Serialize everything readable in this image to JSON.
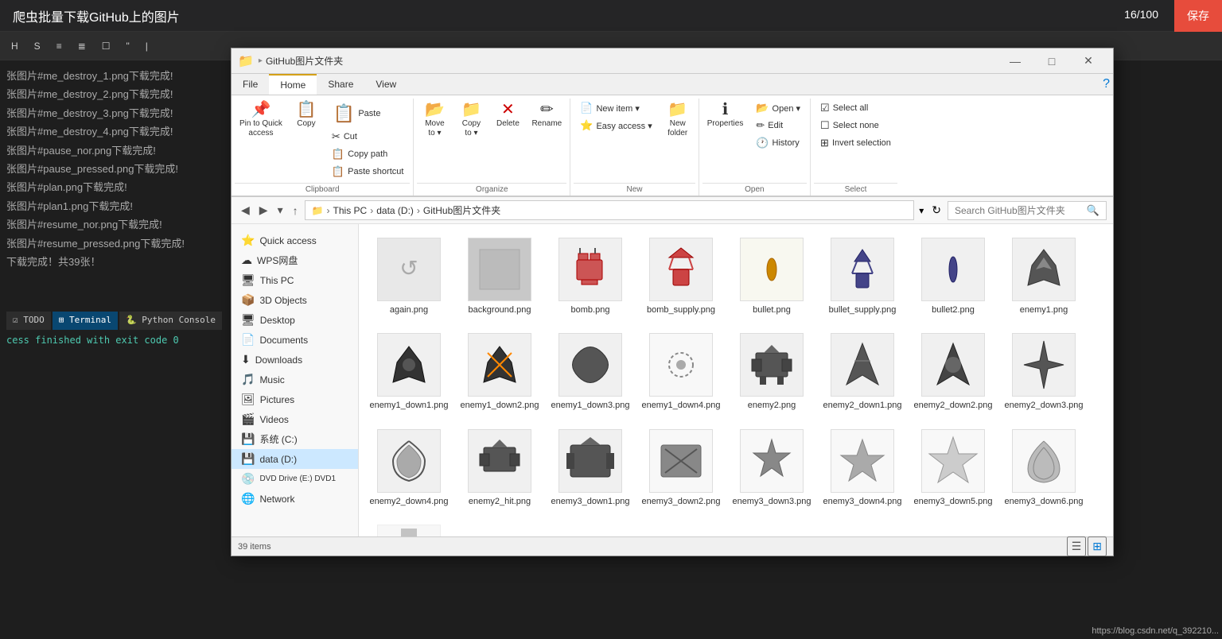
{
  "bg": {
    "title": "爬虫批量下载GitHub上的图片",
    "counter": "16/100",
    "save_label": "保存",
    "toolbar_items": [
      "标题",
      "删除线",
      "无序",
      "有序",
      "待办",
      "引用",
      "行"
    ],
    "log_lines": [
      "张图片#me_destroy_1.png下载完成!",
      "张图片#me_destroy_2.png下载完成!",
      "张图片#me_destroy_3.png下载完成!",
      "张图片#me_destroy_4.png下载完成!",
      "张图片#pause_nor.png下载完成!",
      "张图片#pause_pressed.png下载完成!",
      "张图片#plan.png下载完成!",
      "张图片#plan1.png下载完成!",
      "张图片#resume_nor.png下载完成!",
      "张图片#resume_pressed.png下载完成!",
      "下载完成！共39张！"
    ],
    "terminal_log": "cess finished with exit code 0",
    "tabs": [
      "TODO",
      "Terminal",
      "Python Console"
    ],
    "active_tab": "Terminal",
    "url_bottom": "https://blog.csdn.net/q_392210..."
  },
  "explorer": {
    "title": "GitHub图片文件夹",
    "window_controls": {
      "minimize": "—",
      "maximize": "□",
      "close": "✕"
    },
    "ribbon_tabs": [
      "File",
      "Home",
      "Share",
      "View"
    ],
    "active_tab": "Home",
    "ribbon": {
      "clipboard": {
        "label": "Clipboard",
        "pin_label": "Pin to Quick\naccess",
        "copy_label": "Copy",
        "paste_label": "Paste",
        "cut_label": "Cut",
        "copy_path_label": "Copy path",
        "paste_shortcut_label": "Paste shortcut"
      },
      "organize": {
        "label": "Organize",
        "move_label": "Move\nto",
        "copy_label": "Copy\nto",
        "delete_label": "Delete",
        "rename_label": "Rename"
      },
      "new": {
        "label": "New",
        "new_item_label": "New item ▾",
        "easy_access_label": "Easy access ▾",
        "new_folder_label": "New\nfolder"
      },
      "open": {
        "label": "Open",
        "open_label": "Open ▾",
        "edit_label": "Edit",
        "history_label": "History",
        "properties_label": "Properties"
      },
      "select": {
        "label": "Select",
        "select_all_label": "Select all",
        "select_none_label": "Select none",
        "invert_label": "Invert selection"
      }
    },
    "address": {
      "path_parts": [
        "This PC",
        "data (D:)",
        "GitHub图片文件夹"
      ],
      "search_placeholder": "Search GitHub图片文件夹"
    },
    "sidebar": {
      "quick_access": "Quick access",
      "wps_label": "WPS网盘",
      "this_pc_label": "This PC",
      "items": [
        {
          "label": "3D Objects",
          "icon": "📦"
        },
        {
          "label": "Desktop",
          "icon": "🖥"
        },
        {
          "label": "Documents",
          "icon": "📄"
        },
        {
          "label": "Downloads",
          "icon": "⬇"
        },
        {
          "label": "Music",
          "icon": "🎵"
        },
        {
          "label": "Pictures",
          "icon": "🖼"
        },
        {
          "label": "Videos",
          "icon": "🎬"
        },
        {
          "label": "系统 (C:)",
          "icon": "💾"
        },
        {
          "label": "data (D:)",
          "icon": "💾",
          "selected": true
        },
        {
          "label": "DVD Drive (E:) DVD1",
          "icon": "💿"
        },
        {
          "label": "Network",
          "icon": "🌐"
        }
      ]
    },
    "status_bar": {
      "items_count": "39 items"
    },
    "files": [
      {
        "name": "again.png",
        "icon": "🔄",
        "color": "#888"
      },
      {
        "name": "background.png",
        "icon": "🖼",
        "color": "#bbb"
      },
      {
        "name": "bomb.png",
        "icon": "💣",
        "color": "#c55"
      },
      {
        "name": "bomb_supply.png",
        "icon": "🪂",
        "color": "#c44"
      },
      {
        "name": "bullet.png",
        "icon": "🔶",
        "color": "#c80"
      },
      {
        "name": "bullet_supply.png",
        "icon": "🪂",
        "color": "#448"
      },
      {
        "name": "bullet2.png",
        "icon": "🔷",
        "color": "#448"
      },
      {
        "name": "enemy1.png",
        "icon": "✈",
        "color": "#555"
      },
      {
        "name": "enemy1_down1.png",
        "icon": "✈",
        "color": "#333"
      },
      {
        "name": "enemy1_down2.png",
        "icon": "✈",
        "color": "#333"
      },
      {
        "name": "enemy1_down3.png",
        "icon": "💥",
        "color": "#333"
      },
      {
        "name": "enemy1_down4.png",
        "icon": "💫",
        "color": "#666"
      },
      {
        "name": "enemy2.png",
        "icon": "🚀",
        "color": "#555"
      },
      {
        "name": "enemy2_down1.png",
        "icon": "⭐",
        "color": "#555"
      },
      {
        "name": "enemy2_down2.png",
        "icon": "⭐",
        "color": "#555"
      },
      {
        "name": "enemy2_down3.png",
        "icon": "⭐",
        "color": "#555"
      },
      {
        "name": "enemy2_down4.png",
        "icon": "🌀",
        "color": "#555"
      },
      {
        "name": "enemy2_hit.png",
        "icon": "🚀",
        "color": "#555"
      },
      {
        "name": "enemy3_down1.png",
        "icon": "🚀",
        "color": "#555"
      },
      {
        "name": "enemy3_down2.png",
        "icon": "🚀",
        "color": "#888"
      },
      {
        "name": "enemy3_down3.png",
        "icon": "🌸",
        "color": "#888"
      },
      {
        "name": "enemy3_down4.png",
        "icon": "🌸",
        "color": "#888"
      },
      {
        "name": "enemy3_down5.png",
        "icon": "🌸",
        "color": "#888"
      },
      {
        "name": "enemy3_down6.png",
        "icon": "🌀",
        "color": "#888"
      }
    ]
  }
}
